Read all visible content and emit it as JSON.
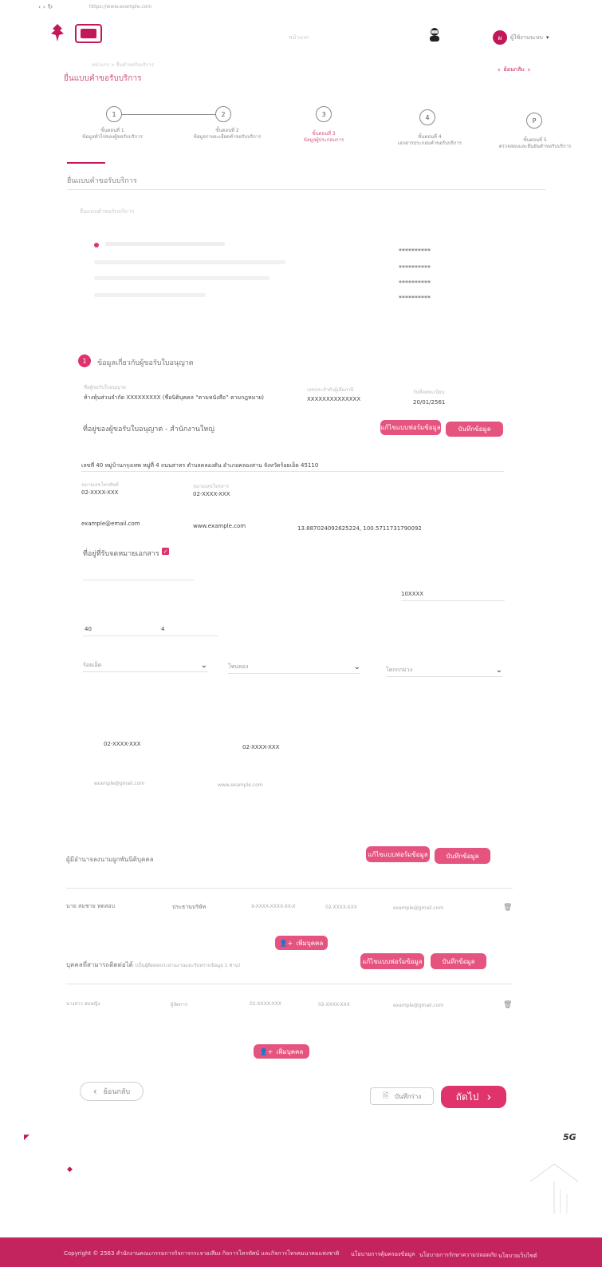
{
  "browser": {
    "url": "https://www.example.com"
  },
  "header": {
    "menu_label": "หน้าแรก",
    "user_label": "ผู้ใช้งานระบบ",
    "breadcrumb": "หน้าแรก > ยื่นคำขอรับบริการ",
    "page_title": "ยื่นแบบคำขอรับบริการ",
    "back_link": "ย้อนกลับ"
  },
  "stepper": {
    "steps": [
      {
        "number": "1",
        "label": "ขั้นตอนที่ 1\nข้อมูลทั่วไปของผู้ขอรับบริการ"
      },
      {
        "number": "2",
        "label": "ขั้นตอนที่ 2\nข้อมูลรายละเอียดคำขอรับบริการ"
      },
      {
        "number": "3",
        "label": "ขั้นตอนที่ 3\nข้อมูลผู้ประกอบการ"
      },
      {
        "number": "4",
        "label": "ขั้นตอนที่ 4\nเอกสารประกอบคำขอรับบริการ"
      },
      {
        "number": "P",
        "label": "ขั้นตอนที่ 5\nตรวจสอบและยืนยันคำขอรับบริการ"
      }
    ]
  },
  "section": {
    "tab_label": "ยื่นแบบคำขอรับบริการ",
    "sub_title": "ยื่นแบบคำขอรับบริการ",
    "masked_value": "**********"
  },
  "company": {
    "heading_number": "1",
    "heading": "ข้อมูลเกี่ยวกับผู้ขอรับใบอนุญาต",
    "name_label": "ชื่อผู้ขอรับใบอนุญาต",
    "name_value": "ห้างหุ้นส่วนจำกัด XXXXXXXXX (ชื่อนิติบุคคล “ตามหนังสือ” ตามกฎหมาย)",
    "taxid_label": "เลขประจำตัวผู้เสียภาษี",
    "taxid_value": "XXXXXXXXXXXXXX",
    "date_label": "วันที่จดทะเบียน",
    "date_value": "20/01/2561",
    "address_heading": "ที่อยู่ของผู้ขอรับใบอนุญาต - สำนักงานใหญ่",
    "edit_button": "แก้ไขแบบฟอร์มข้อมูล",
    "save_button": "บันทึกข้อมูล",
    "address_value": "เลขที่ 40 หมู่บ้านกรุงเทพ หมู่ที่ 4 ถนนสาทร ตำบลคลองตัน อำเภอคลองสาน จังหวัดร้อยเอ็ด 45110",
    "phone_label": "หมายเลขโทรศัพท์",
    "phone_value": "02-XXXX-XXX",
    "fax_label": "หมายเลขโทรสาร",
    "fax_value": "02-XXXX-XXX",
    "email_value": "example@email.com",
    "website_value": "www.example.com",
    "coords_value": "13.887024092625224, 100.5711731790092"
  },
  "doc_address": {
    "heading": "ที่อยู่ที่รับจดหมายเอกสาร",
    "postcode_value": "10XXXX",
    "house_value": "40",
    "moo_value": "4",
    "province_select": "ร้อยเอ็ด",
    "district_select": "โพนทอง",
    "subdistrict_select": "โคกกกม่วง",
    "phone_value": "02-XXXX-XXX",
    "fax_value": "02-XXXX-XXX",
    "email_value": "example@gmail.com",
    "website_value": "www.example.com"
  },
  "signers": {
    "heading": "ผู้มีอำนาจลงนามผูกพันนิติบุคคล",
    "edit_button": "แก้ไขแบบฟอร์มข้อมูล",
    "save_button": "บันทึกข้อมูล",
    "row_name": "นาย สมชาย ทดสอบ",
    "row_role": "ประธานบริษัท",
    "row_id": "X-XXXX-XXXX-XX-X",
    "row_phone": "02-XXXX-XXX",
    "row_email": "example@gmail.com",
    "add_button": "เพิ่มบุคคล"
  },
  "contacts": {
    "heading": "บุคคลที่สามารถติดต่อได้",
    "heading_note": "(เป็นผู้ติดต่อประสานงานและรับทราบข้อมูล 1 ท่าน)",
    "edit_button": "แก้ไขแบบฟอร์มข้อมูล",
    "save_button": "บันทึกข้อมูล",
    "row_name": "นางสาว สมหญิง",
    "row_role": "ผู้จัดการ",
    "row_phone": "02-XXXX-XXX",
    "row_mobile": "02-XXXX-XXX",
    "row_email": "example@gmail.com",
    "add_button": "เพิ่มบุคคล"
  },
  "actions": {
    "back_button": "ย้อนกลับ",
    "draft_button": "บันทึกร่าง",
    "next_button": "ถัดไป"
  },
  "footer": {
    "copyright": "Copyright © 2563 สำนักงานคณะกรรมการกิจการกระจายเสียง กิจการโทรทัศน์ และกิจการโทรคมนาคมแห่งชาติ",
    "link1": "นโยบายการคุ้มครองข้อมูล",
    "link2": "นโยบายการรักษาความปลอดภัย",
    "link3": "นโยบายเว็บไซต์"
  },
  "status_overlay": {
    "network": "5G"
  },
  "colors": {
    "accent": "#e0336b",
    "footer": "#c3245d"
  }
}
